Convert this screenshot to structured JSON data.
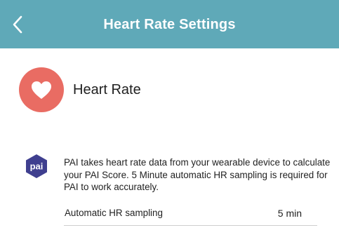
{
  "header": {
    "title": "Heart Rate Settings",
    "back_icon": "chevron-left-icon",
    "background_color": "#5fa9b8"
  },
  "heart_rate": {
    "title": "Heart Rate",
    "icon": "heart-icon",
    "icon_color": "#e96c63"
  },
  "pai": {
    "badge_text": "pai",
    "badge_color": "#3f3f8f",
    "description": "PAI takes heart rate data from your wearable device to calculate your PAI Score. 5 Minute automatic HR sampling is required for PAI to work accurately."
  },
  "settings": {
    "sampling_label": "Automatic HR sampling",
    "sampling_value": "5 min"
  }
}
